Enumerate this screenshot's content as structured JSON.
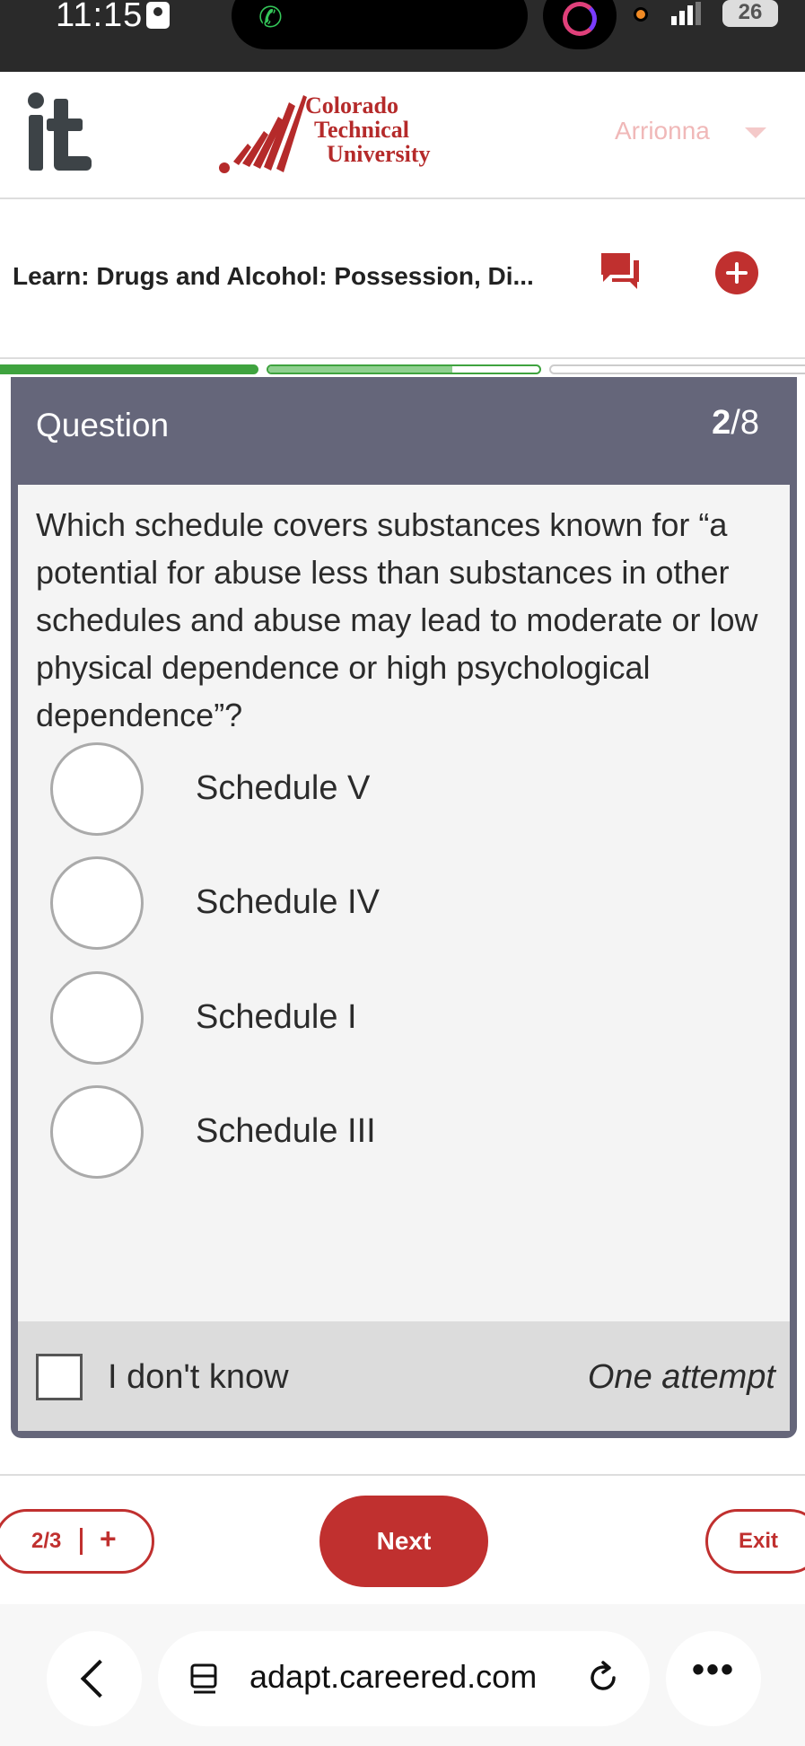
{
  "status_bar": {
    "time": "11:15",
    "battery": "26"
  },
  "header": {
    "logo_mark": "it",
    "university_lines": [
      "Colorado",
      "Technical",
      "University"
    ],
    "user_name": "Arrionna"
  },
  "course": {
    "title": "Learn: Drugs and Alcohol: Possession, Di..."
  },
  "progress": {
    "segments": [
      1.0,
      0.68,
      0.0
    ]
  },
  "question": {
    "label": "Question",
    "current": "2",
    "total": "/8",
    "text": "Which schedule covers substances known for “a potential for abuse less than substances in other schedules and abuse may lead to moderate or low physical dependence or high psychological dependence”?",
    "options": [
      "Schedule V",
      "Schedule IV",
      "Schedule I",
      "Schedule III"
    ],
    "idk_label": "I don't know",
    "attempt_label": "One attempt"
  },
  "actions": {
    "pager_count": "2/3",
    "pager_plus": "+",
    "next_label": "Next",
    "exit_label": "Exit"
  },
  "browser": {
    "url": "adapt.careered.com",
    "more": "•••"
  },
  "colors": {
    "brand_red": "#c0302f",
    "progress_green": "#3fa33f",
    "card_header": "#65667a"
  }
}
